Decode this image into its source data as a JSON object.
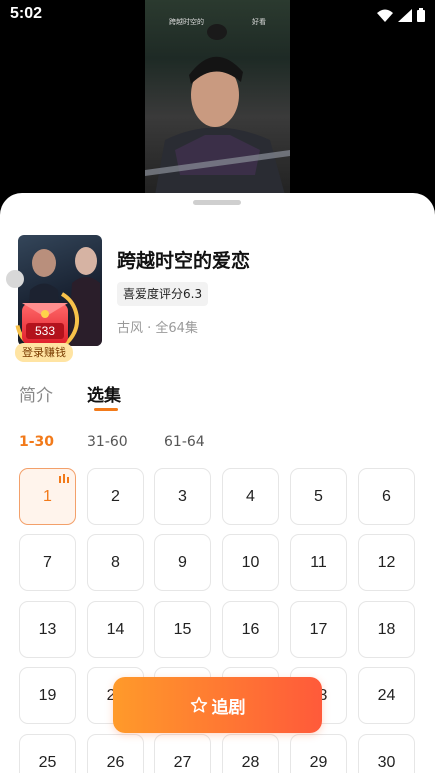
{
  "status": {
    "time": "5:02"
  },
  "video": {
    "top_left_text": "跨越时空的",
    "top_right_text": "好看"
  },
  "drama": {
    "title": "跨越时空的爱恋",
    "rating": "喜爱度评分6.3",
    "meta": "古风 · 全64集"
  },
  "reward": {
    "coins": "533",
    "label": "登录赚钱"
  },
  "tabs": {
    "intro": "简介",
    "episodes": "选集"
  },
  "ranges": [
    "1-30",
    "31-60",
    "61-64"
  ],
  "episodes": [
    "1",
    "2",
    "3",
    "4",
    "5",
    "6",
    "7",
    "8",
    "9",
    "10",
    "11",
    "12",
    "13",
    "14",
    "15",
    "16",
    "17",
    "18",
    "19",
    "20",
    "21",
    "22",
    "23",
    "24",
    "25",
    "26",
    "27",
    "28",
    "29",
    "30"
  ],
  "follow_button": {
    "label": "追剧",
    "icon": "star-icon"
  },
  "colors": {
    "accent": "#f27a1a",
    "button_start": "#ff9a2a",
    "button_end": "#ff5a3a"
  }
}
